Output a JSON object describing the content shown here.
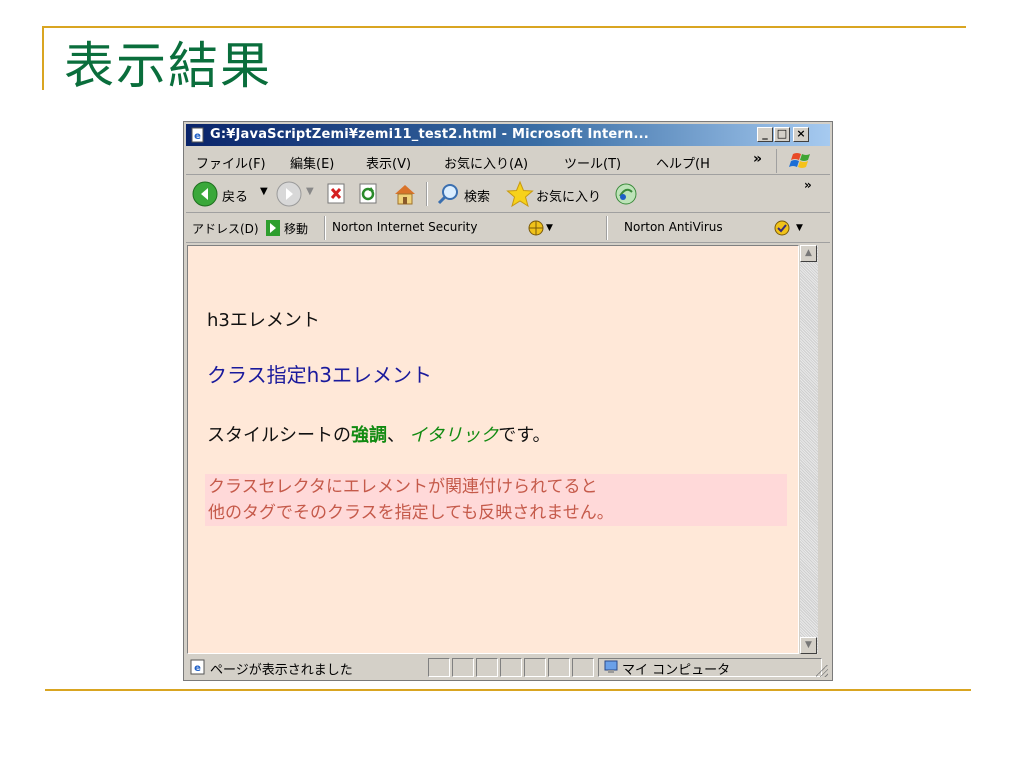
{
  "slide": {
    "title": "表示結果"
  },
  "window": {
    "title": "G:¥JavaScriptZemi¥zemi11_test2.html - Microsoft Intern...",
    "controls": {
      "minimize": "_",
      "maximize": "□",
      "close": "×"
    }
  },
  "menu": {
    "items": [
      "ファイル(F)",
      "編集(E)",
      "表示(V)",
      "お気に入り(A)",
      "ツール(T)",
      "ヘルプ(H"
    ],
    "overflow": "»"
  },
  "toolbar": {
    "back": "戻る",
    "search": "検索",
    "favorites": "お気に入り",
    "overflow": "»"
  },
  "addressbar": {
    "address_label": "アドレス(D)",
    "go_label": "移動",
    "norton_security": "Norton Internet Security",
    "norton_antivirus": "Norton AntiVirus"
  },
  "content": {
    "h3_plain": "h3エレメント",
    "h3_class": "クラス指定h3エレメント",
    "para_before": "スタイルシートの",
    "para_strong": "強調",
    "para_sep": "、",
    "para_italic": "イタリック",
    "para_after": "です。",
    "note_line1": "クラスセレクタにエレメントが関連付けられてると",
    "note_line2": "他のタグでそのクラスを指定しても反映されません。"
  },
  "statusbar": {
    "status": "ページが表示されました",
    "zone": "マイ コンピュータ"
  }
}
